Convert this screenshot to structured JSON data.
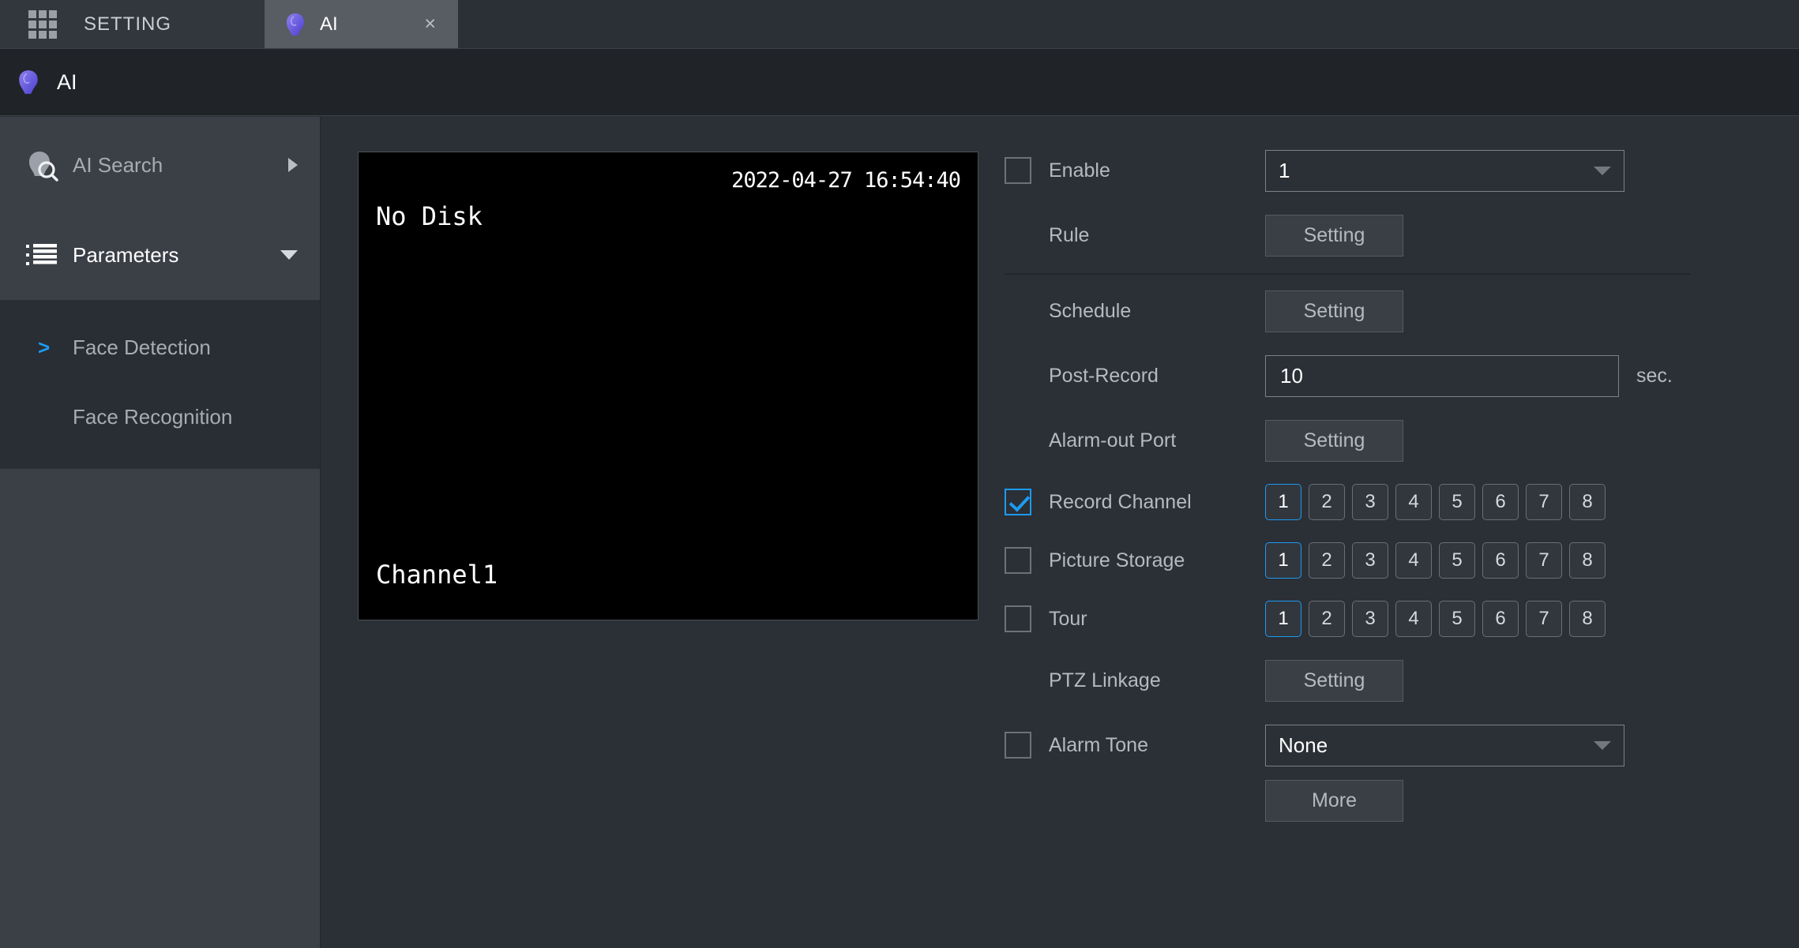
{
  "tabbar": {
    "grid_icon": "grid-icon",
    "setting_label": "SETTING",
    "ai_tab": {
      "icon": "ai-head-icon",
      "label": "AI",
      "close_label": "×"
    }
  },
  "ai_header": {
    "icon": "ai-head-icon",
    "title": "AI"
  },
  "sidebar": {
    "items": [
      {
        "label": "AI Search",
        "icon": "ai-search-icon",
        "caret": "caret-right",
        "expanded": false
      },
      {
        "label": "Parameters",
        "icon": "list-icon",
        "caret": "caret-down",
        "expanded": true
      }
    ],
    "submenu": [
      {
        "label": "Face Detection",
        "chevron": ">",
        "active": true
      },
      {
        "label": "Face Recognition",
        "chevron": "",
        "active": false
      }
    ]
  },
  "video_preview": {
    "datetime": "2022-04-27 16:54:40",
    "status": "No Disk",
    "channel": "Channel1"
  },
  "form": {
    "enable": {
      "label": "Enable",
      "checked": false
    },
    "channel_select": {
      "value": "1",
      "caret": "chevron-down-icon"
    },
    "rule": {
      "label": "Rule",
      "button": "Setting"
    },
    "schedule": {
      "label": "Schedule",
      "button": "Setting"
    },
    "post_record": {
      "label": "Post-Record",
      "value": "10",
      "unit": "sec."
    },
    "alarm_out_port": {
      "label": "Alarm-out Port",
      "button": "Setting"
    },
    "record_channel": {
      "label": "Record Channel",
      "checked": true,
      "channels": [
        "1",
        "2",
        "3",
        "4",
        "5",
        "6",
        "7",
        "8"
      ],
      "selected": [
        "1"
      ]
    },
    "picture_storage": {
      "label": "Picture Storage",
      "checked": false,
      "channels": [
        "1",
        "2",
        "3",
        "4",
        "5",
        "6",
        "7",
        "8"
      ],
      "selected": [
        "1"
      ]
    },
    "tour": {
      "label": "Tour",
      "checked": false,
      "channels": [
        "1",
        "2",
        "3",
        "4",
        "5",
        "6",
        "7",
        "8"
      ],
      "selected": [
        "1"
      ]
    },
    "ptz_linkage": {
      "label": "PTZ Linkage",
      "button": "Setting"
    },
    "alarm_tone": {
      "label": "Alarm Tone",
      "checked": false,
      "value": "None",
      "caret": "chevron-down-icon"
    },
    "more": {
      "button": "More"
    }
  },
  "colors": {
    "accent": "#1c9bf0",
    "page_bg": "#2b2f36",
    "sidebar_bg": "#3b3f46",
    "submenu_bg": "#292d34",
    "header_bg": "#202429",
    "tab_active_bg": "#585c63",
    "text_primary": "#ffffff",
    "text_secondary": "#b5bac1"
  }
}
